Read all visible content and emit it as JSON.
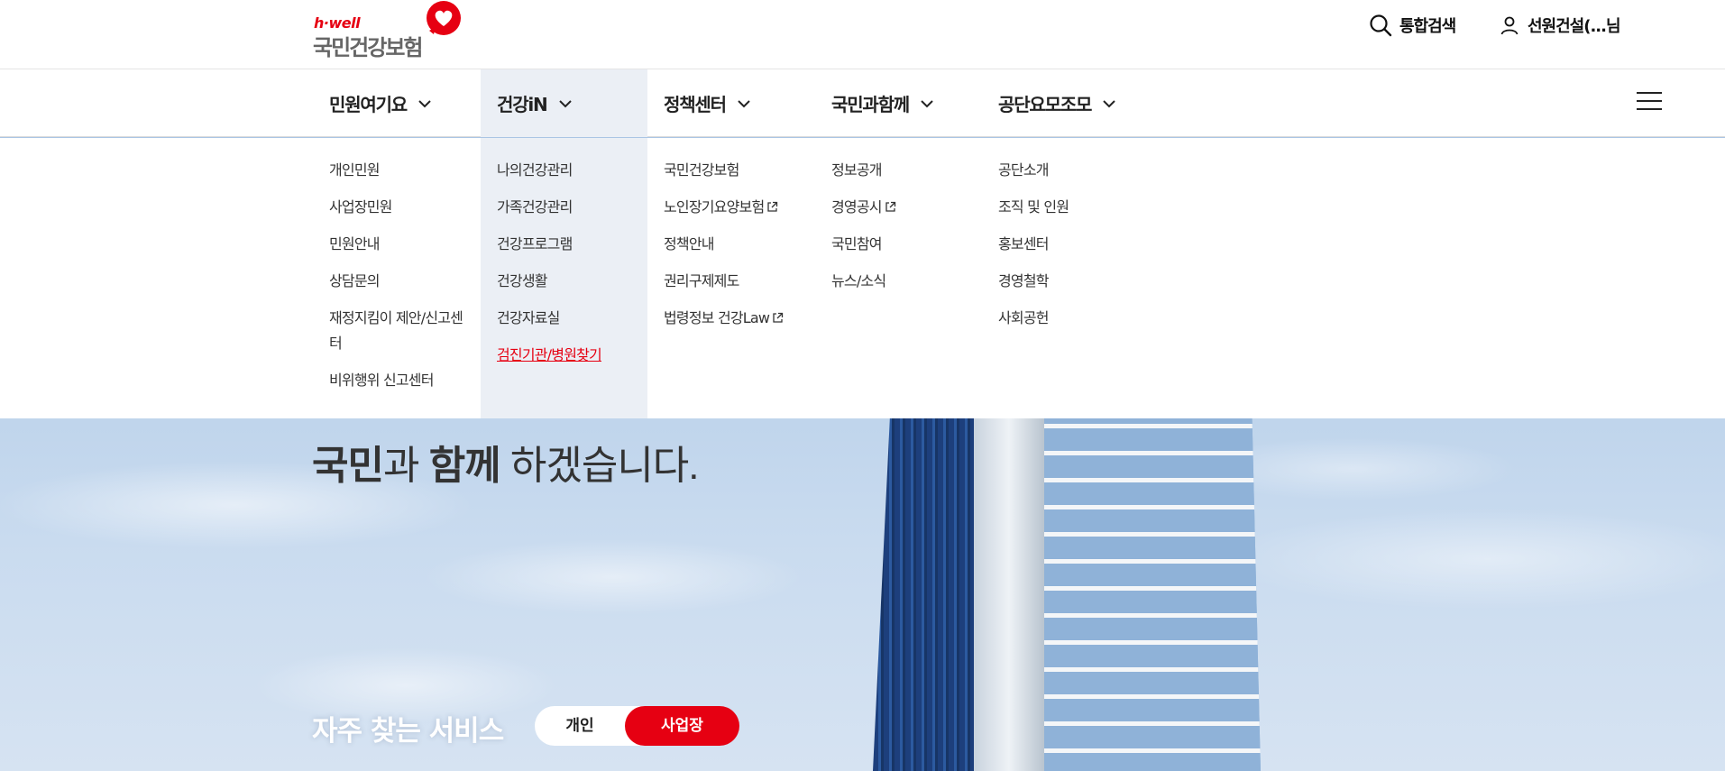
{
  "header": {
    "logo": {
      "tagline": "h·well",
      "name": "국민건강보험"
    },
    "search_label": "통합검색",
    "user_label": "선원건설(...님"
  },
  "nav": {
    "items": [
      {
        "label": "민원여기요"
      },
      {
        "label": "건강iN"
      },
      {
        "label": "정책센터"
      },
      {
        "label": "국민과함께"
      },
      {
        "label": "공단요모조모"
      }
    ],
    "active_index": 1
  },
  "mega_menu": {
    "columns": [
      {
        "links": [
          "개인민원",
          "사업장민원",
          "민원안내",
          "상담문의",
          "재정지킴이 제안/신고센터",
          "비위행위 신고센터"
        ]
      },
      {
        "links": [
          "나의건강관리",
          "가족건강관리",
          "건강프로그램",
          "건강생활",
          "건강자료실",
          "검진기관/병원찾기"
        ]
      },
      {
        "links": [
          "국민건강보험",
          "노인장기요양보험",
          "정책안내",
          "권리구제제도",
          "법령정보 건강Law"
        ]
      },
      {
        "links": [
          "정보공개",
          "경영공시",
          "국민참여",
          "뉴스/소식"
        ]
      },
      {
        "links": [
          "공단소개",
          "조직 및 인원",
          "홍보센터",
          "경영철학",
          "사회공헌"
        ]
      }
    ],
    "highlighted_link": "검진기관/병원찾기"
  },
  "hero": {
    "line_part1": "국민",
    "line_part2": "과 ",
    "line_part3": "함께",
    "line_part4": " 하겠습니다."
  },
  "services": {
    "label": "자주 찾는 서비스",
    "toggle": [
      {
        "label": "개인"
      },
      {
        "label": "사업장"
      }
    ],
    "active": "사업장"
  },
  "colors": {
    "brand_red": "#e60012",
    "active_menu_bg": "#ebeff5"
  }
}
